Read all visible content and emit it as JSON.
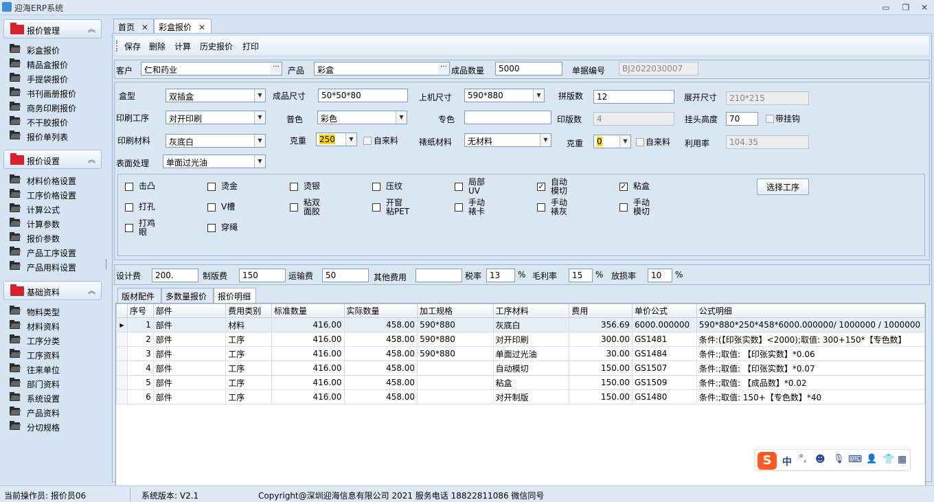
{
  "window": {
    "title": "迎海ERP系统"
  },
  "sidebar": {
    "sections": [
      {
        "title": "报价管理",
        "items": [
          "彩盒报价",
          "精品盒报价",
          "手提袋报价",
          "书刊画册报价",
          "商务印刷报价",
          "不干胶报价",
          "报价单列表"
        ]
      },
      {
        "title": "报价设置",
        "items": [
          "材料价格设置",
          "工序价格设置",
          "计算公式",
          "计算参数",
          "报价参数",
          "产品工序设置",
          "产品用料设置"
        ]
      },
      {
        "title": "基础资料",
        "items": [
          "物料类型",
          "材料资料",
          "工序分类",
          "工序资料",
          "往来单位",
          "部门资料",
          "系统设置",
          "产品资料",
          "分切规格"
        ]
      }
    ]
  },
  "tabs": [
    {
      "label": "首页"
    },
    {
      "label": "彩盒报价"
    }
  ],
  "toolbar": {
    "save": "保存",
    "delete": "删除",
    "calc": "计算",
    "history": "历史报价",
    "print": "打印"
  },
  "header_row": {
    "customer_label": "客户",
    "customer": "仁和药业",
    "product_label": "产品",
    "product": "彩盒",
    "qty_label": "成品数量",
    "qty": "5000",
    "docno_label": "单据编号",
    "docno": "BJ2022030007"
  },
  "spec": {
    "box_type_label": "盒型",
    "box_type": "双插盒",
    "size_label": "成品尺寸",
    "size": "50*50*80",
    "machine_size_label": "上机尺寸",
    "machine_size": "590*880",
    "imposition_label": "拼版数",
    "imposition": "12",
    "unfold_label": "展开尺寸",
    "unfold": "210*215",
    "print_proc_label": "印刷工序",
    "print_proc": "对开印刷",
    "color_label": "普色",
    "color": "彩色",
    "spot_label": "专色",
    "spot": "",
    "plates_label": "印版数",
    "plates": "4",
    "hang_label": "挂头高度",
    "hang": "70",
    "hook_label": "带挂钩",
    "material_label": "印刷材料",
    "material": "灰底白",
    "weight_label": "克重",
    "weight": "250",
    "self_supply_label": "自来料",
    "mount_label": "裱纸材料",
    "mount": "无材料",
    "weight2_label": "克重",
    "weight2": "0",
    "self_supply2_label": "自来料",
    "util_label": "利用率",
    "util": "104.35",
    "surface_label": "表面处理",
    "surface": "单面过光油"
  },
  "processes": [
    {
      "label": "击凸",
      "checked": false
    },
    {
      "label": "烫金",
      "checked": false
    },
    {
      "label": "烫银",
      "checked": false
    },
    {
      "label": "压纹",
      "checked": false
    },
    {
      "label": "局部\nUV",
      "checked": false
    },
    {
      "label": "自动\n模切",
      "checked": true
    },
    {
      "label": "粘盒",
      "checked": true
    },
    {
      "label": "打孔",
      "checked": false
    },
    {
      "label": "V槽",
      "checked": false
    },
    {
      "label": "粘双\n面胶",
      "checked": false
    },
    {
      "label": "开窗\n粘PET",
      "checked": false
    },
    {
      "label": "手动\n裱卡",
      "checked": false
    },
    {
      "label": "手动\n裱灰",
      "checked": false
    },
    {
      "label": "手动\n模切",
      "checked": false
    },
    {
      "label": "打鸡\n眼",
      "checked": false
    },
    {
      "label": "穿绳",
      "checked": false
    }
  ],
  "select_process_button": "选择工序",
  "fees": {
    "design_label": "设计费",
    "design": "200.",
    "plate_label": "制版费",
    "plate": "150",
    "ship_label": "运输费",
    "ship": "50",
    "other_label": "其他费用",
    "other": "",
    "tax_label": "税率",
    "tax": "13",
    "margin_label": "毛利率",
    "margin": "15",
    "loss_label": "放损率",
    "loss": "10",
    "pct": "%"
  },
  "grid_tabs": [
    "版材配件",
    "多数量报价",
    "报价明细"
  ],
  "grid": {
    "columns": [
      "序号",
      "部件",
      "费用类别",
      "标准数量",
      "实际数量",
      "加工规格",
      "工序材料",
      "费用",
      "单价公式",
      "公式明细"
    ],
    "rows": [
      [
        "1",
        "部件",
        "材料",
        "416.00",
        "458.00",
        "590*880",
        "灰底白",
        "356.69",
        "6000.000000",
        "590*880*250*458*6000.000000/ 1000000 / 1000000"
      ],
      [
        "2",
        "部件",
        "工序",
        "416.00",
        "458.00",
        "590*880",
        "对开印刷",
        "300.00",
        "GS1481",
        "条件:(【印张实数】<2000);取值: 300+150*【专色数】"
      ],
      [
        "3",
        "部件",
        "工序",
        "416.00",
        "458.00",
        "590*880",
        "单面过光油",
        "30.00",
        "GS1484",
        "条件:;取值: 【印张实数】*0.06"
      ],
      [
        "4",
        "部件",
        "工序",
        "416.00",
        "458.00",
        "",
        "自动模切",
        "150.00",
        "GS1507",
        "条件:;取值: 【印张实数】*0.07"
      ],
      [
        "5",
        "部件",
        "工序",
        "416.00",
        "458.00",
        "",
        "粘盒",
        "150.00",
        "GS1509",
        "条件:;取值: 【成品数】*0.02"
      ],
      [
        "6",
        "部件",
        "工序",
        "416.00",
        "458.00",
        "",
        "对开制版",
        "150.00",
        "GS1480",
        "条件:;取值: 150+【专色数】*40"
      ]
    ]
  },
  "ime": {
    "lang": "中"
  },
  "status": {
    "operator": "当前操作员: 报价员06",
    "version": "系统版本:  V2.1",
    "copyright": "Copyright@深圳迎海信息有限公司 2021   服务电话 18822811086 微信同号"
  },
  "colors": {
    "accent": "#d8202a",
    "highlight": "#ffd200",
    "background": "#d6e3f2"
  }
}
